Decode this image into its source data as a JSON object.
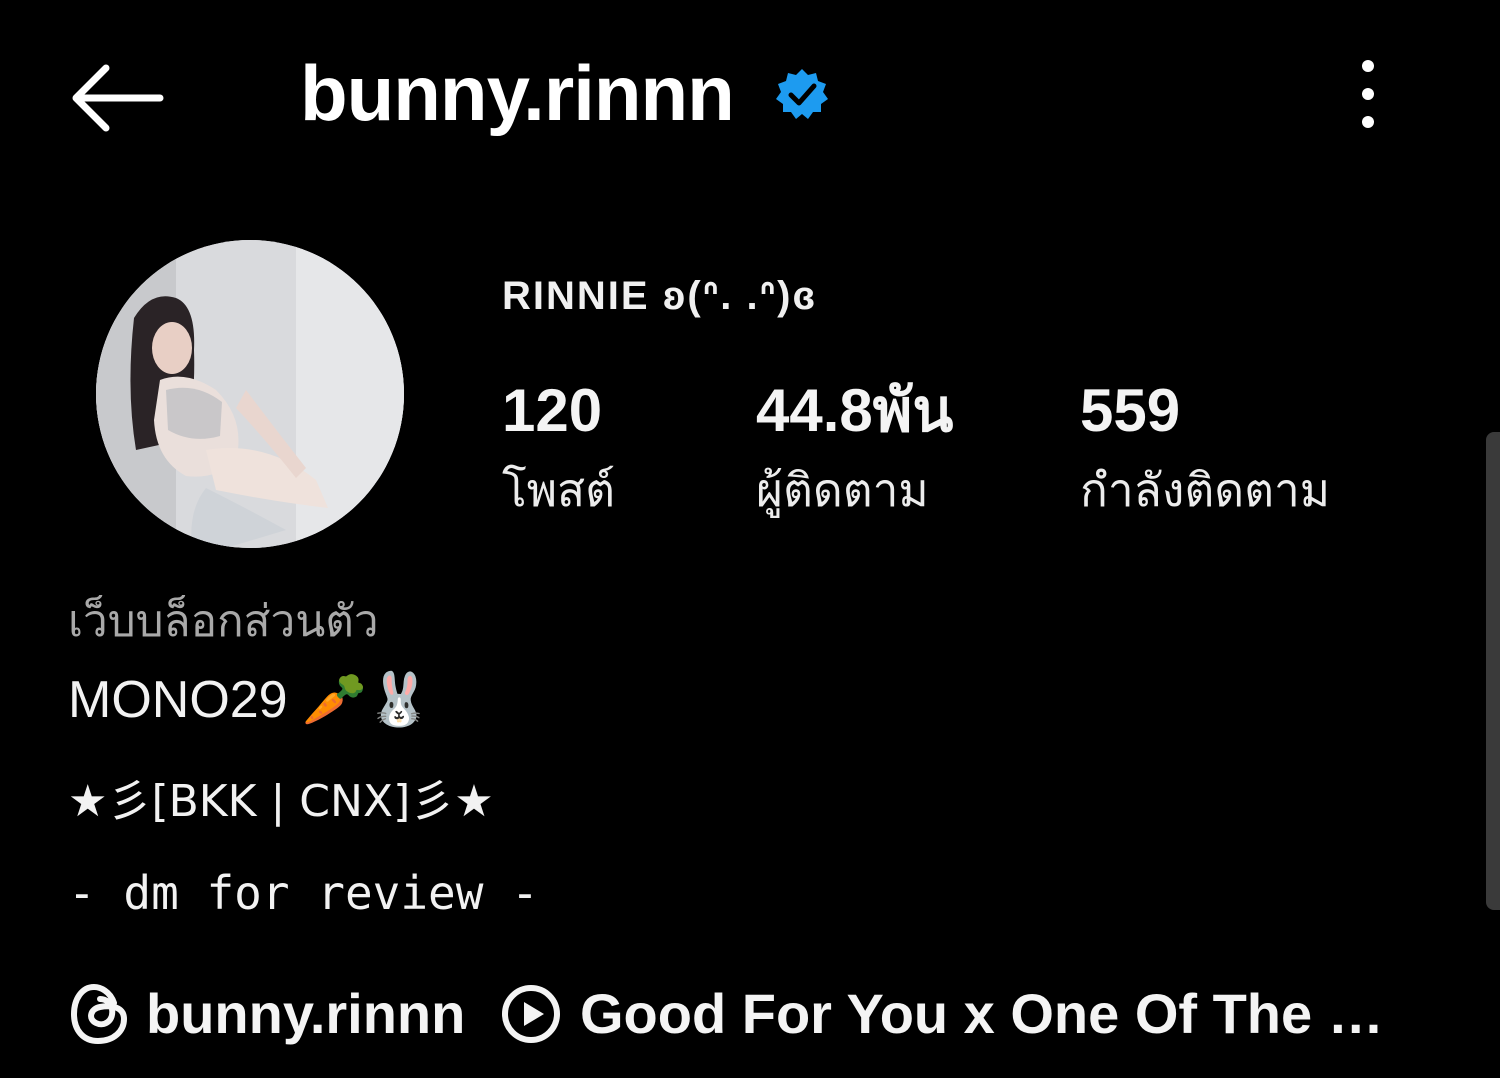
{
  "header": {
    "username": "bunny.rinnn",
    "back_icon": "arrow-left-icon",
    "verified_icon": "verified-badge-icon",
    "menu_icon": "more-vertical-icon",
    "verified_color": "#1d9bf0"
  },
  "profile": {
    "display_name": "RINNIE ʚ(ᐢ. .ᐢ)ɞ",
    "stats": [
      {
        "value": "120",
        "label": "โพสต์"
      },
      {
        "value": "44.8พัน",
        "label": "ผู้ติดตาม"
      },
      {
        "value": "559",
        "label": "กำลังติดตาม"
      }
    ]
  },
  "bio": {
    "category": "เว็บบล็อกส่วนตัว",
    "line1": "MONO29 🥕🐰",
    "line2": "★彡[BKK | CNX]彡★",
    "line3": "- dm for review -"
  },
  "links": {
    "threads_icon": "threads-icon",
    "threads_handle": "bunny.rinnn",
    "music_icon": "play-circle-icon",
    "music_title": "Good For You x One Of The Gir..."
  }
}
